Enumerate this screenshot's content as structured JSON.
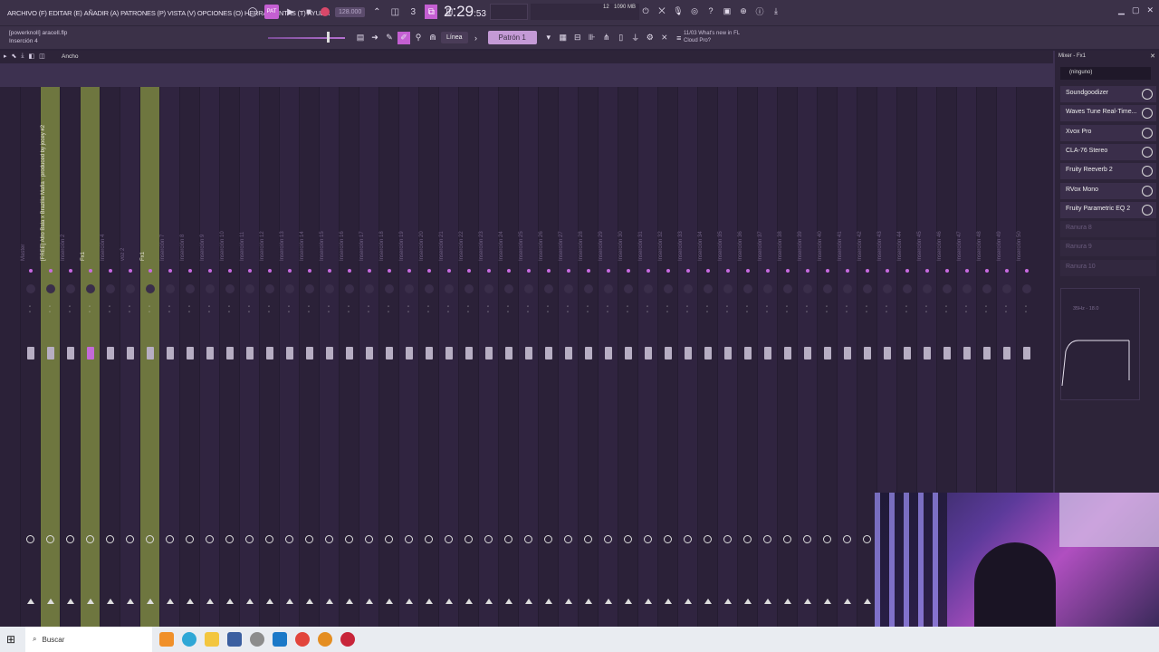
{
  "menu": {
    "items": [
      "ARCHIVO (F)",
      "EDITAR (E)",
      "AÑADIR (A)",
      "PATRONES (P)",
      "VISTA (V)",
      "OPCIONES (O)",
      "HERRAMIENTAS (T)",
      "AYUDA"
    ]
  },
  "transport": {
    "pattern_label": "PAT",
    "tempo": "128.000",
    "time_main": "2:29",
    "time_sub": ":53"
  },
  "monitor": {
    "cpu": "12",
    "ram": "1090 MB",
    "extra": "0"
  },
  "file": {
    "hint": "[powerknoll] aracell.flp",
    "hint2": "Inserción 4"
  },
  "toolbar2": {
    "snap": "Línea",
    "pattern": "Patrón 1",
    "news_line1": "11/03  What's new in FL",
    "news_line2": "Cloud Pro?"
  },
  "mixer": {
    "view_label": "Ancho",
    "strips": [
      {
        "name": "Master",
        "green": false
      },
      {
        "name": "[FREE] Afro Bala x Brazilia Mafia - produced by jocey #2",
        "green": true
      },
      {
        "name": "Inserción 2",
        "green": false
      },
      {
        "name": "Fx1",
        "green": true
      },
      {
        "name": "Inserción 4",
        "green": false
      },
      {
        "name": "voz 2",
        "green": false
      },
      {
        "name": "Fx1",
        "green": true
      },
      {
        "name": "Inserción 7",
        "green": false
      },
      {
        "name": "Inserción 8",
        "green": false
      },
      {
        "name": "Inserción 9",
        "green": false
      },
      {
        "name": "Inserción 10",
        "green": false
      },
      {
        "name": "Inserción 11",
        "green": false
      },
      {
        "name": "Inserción 12",
        "green": false
      },
      {
        "name": "Inserción 13",
        "green": false
      },
      {
        "name": "Inserción 14",
        "green": false
      },
      {
        "name": "Inserción 15",
        "green": false
      },
      {
        "name": "Inserción 16",
        "green": false
      },
      {
        "name": "Inserción 17",
        "green": false
      },
      {
        "name": "Inserción 18",
        "green": false
      },
      {
        "name": "Inserción 19",
        "green": false
      },
      {
        "name": "Inserción 20",
        "green": false
      },
      {
        "name": "Inserción 21",
        "green": false
      },
      {
        "name": "Inserción 22",
        "green": false
      },
      {
        "name": "Inserción 23",
        "green": false
      },
      {
        "name": "Inserción 24",
        "green": false
      },
      {
        "name": "Inserción 25",
        "green": false
      },
      {
        "name": "Inserción 26",
        "green": false
      },
      {
        "name": "Inserción 27",
        "green": false
      },
      {
        "name": "Inserción 28",
        "green": false
      },
      {
        "name": "Inserción 29",
        "green": false
      },
      {
        "name": "Inserción 30",
        "green": false
      },
      {
        "name": "Inserción 31",
        "green": false
      },
      {
        "name": "Inserción 32",
        "green": false
      },
      {
        "name": "Inserción 33",
        "green": false
      },
      {
        "name": "Inserción 34",
        "green": false
      },
      {
        "name": "Inserción 35",
        "green": false
      },
      {
        "name": "Inserción 36",
        "green": false
      },
      {
        "name": "Inserción 37",
        "green": false
      },
      {
        "name": "Inserción 38",
        "green": false
      },
      {
        "name": "Inserción 39",
        "green": false
      },
      {
        "name": "Inserción 40",
        "green": false
      },
      {
        "name": "Inserción 41",
        "green": false
      },
      {
        "name": "Inserción 42",
        "green": false
      },
      {
        "name": "Inserción 43",
        "green": false
      },
      {
        "name": "Inserción 44",
        "green": false
      },
      {
        "name": "Inserción 45",
        "green": false
      },
      {
        "name": "Inserción 46",
        "green": false
      },
      {
        "name": "Inserción 47",
        "green": false
      },
      {
        "name": "Inserción 48",
        "green": false
      },
      {
        "name": "Inserción 49",
        "green": false
      },
      {
        "name": "Inserción 50",
        "green": false
      },
      {
        "name": "Inserción 51",
        "green": false
      },
      {
        "name": "Inserción 52",
        "green": false
      }
    ]
  },
  "mixer_panel": {
    "title": "Mixer - Fx1",
    "input": "(ninguno)",
    "slots": [
      {
        "label": "Soundgoodizer",
        "empty": false
      },
      {
        "label": "Waves Tune Real-Time...",
        "empty": false
      },
      {
        "label": "Xvox Pro",
        "empty": false
      },
      {
        "label": "CLA-76 Stereo",
        "empty": false
      },
      {
        "label": "Fruity Reeverb 2",
        "empty": false
      },
      {
        "label": "RVox Mono",
        "empty": false
      },
      {
        "label": "Fruity Parametric EQ 2",
        "empty": false
      },
      {
        "label": "Ranura 8",
        "empty": true
      },
      {
        "label": "Ranura 9",
        "empty": true
      },
      {
        "label": "Ranura 10",
        "empty": true
      }
    ],
    "eq_label": "35Hz - 18.0"
  },
  "taskbar": {
    "search_placeholder": "Buscar"
  },
  "colors": {
    "accent": "#c45fd2",
    "green_strip": "#a5be46",
    "background": "#2b2138"
  }
}
